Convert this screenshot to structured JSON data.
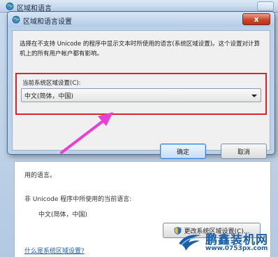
{
  "parent_window": {
    "title": "区域和语言",
    "panel_text_top": "用的语言。",
    "current_lang_label": "非 Unicode 程序中所使用的当前语言:",
    "current_lang_value": "中文(简体，中国)",
    "change_button": "更改系统区域设置(C)...",
    "help_link": "什么是系统区域设置?"
  },
  "dialog": {
    "title": "区域和语言设置",
    "close_label": "x",
    "description": "选择在不支持 Unicode 的程序中显示文本时所使用的语言(系统区域设置)。这个设置对计算机上的所有用户帐户都有影响。",
    "locale_label": "当前系统区域设置(C):",
    "locale_value": "中文(简体，中国)",
    "ok_label": "确定",
    "cancel_label": "取消"
  },
  "watermark": {
    "name": "鹏鑫装机网",
    "url": "www.0753px.com"
  },
  "colors": {
    "highlight": "#e0222b",
    "arrow": "#e83fd6",
    "dialog_close": "#c9452a",
    "watermark": "#1b5fa6"
  }
}
